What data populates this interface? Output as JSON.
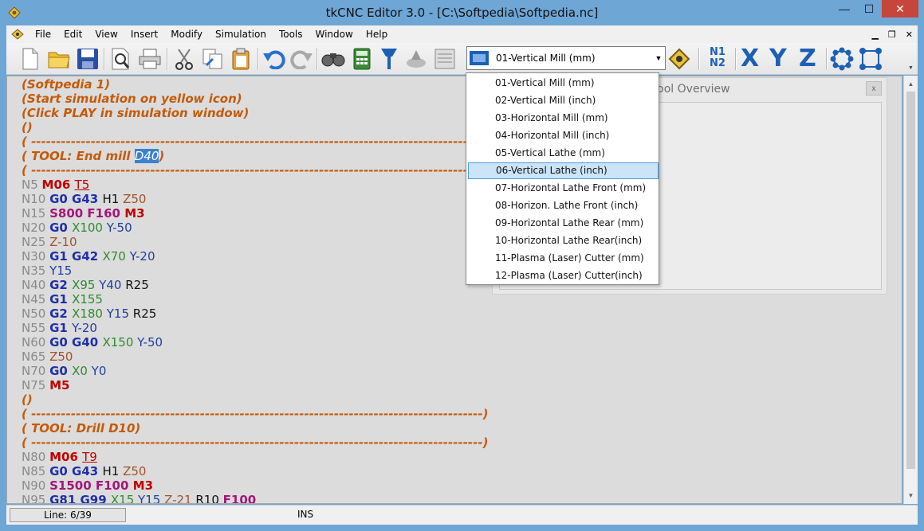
{
  "window": {
    "title": "tkCNC Editor 3.0 - [C:\\Softpedia\\Softpedia.nc]",
    "minimize": "—",
    "maximize": "☐",
    "close": "✕"
  },
  "menu": {
    "items": [
      "File",
      "Edit",
      "View",
      "Insert",
      "Modify",
      "Simulation",
      "Tools",
      "Window",
      "Help"
    ],
    "mdi_minimize": "▁",
    "mdi_restore": "❐",
    "mdi_close": "✕"
  },
  "toolbar": {
    "machine_selected": "01-Vertical Mill (mm)",
    "n1n2_top": "N1",
    "n1n2_bottom": "N2",
    "axis_x": "X",
    "axis_y": "Y",
    "axis_z": "Z",
    "icons": [
      "new-file-icon",
      "open-folder-icon",
      "save-icon",
      "print-preview-icon",
      "print-icon",
      "cut-icon",
      "copy-icon",
      "paste-icon",
      "undo-icon",
      "redo-icon",
      "find-icon",
      "calculator-icon",
      "tool-icon",
      "simulation-icon",
      "machine-icon",
      "tool-insert-icon",
      "renumber-icon",
      "bolt-circle-icon",
      "grid-pattern-icon"
    ]
  },
  "dropdown": {
    "options": [
      "01-Vertical Mill (mm)",
      "02-Vertical Mill (inch)",
      "03-Horizontal Mill (mm)",
      "04-Horizontal Mill (inch)",
      "05-Vertical Lathe (mm)",
      "06-Vertical Lathe (inch)",
      "07-Horizontal Lathe Front (mm)",
      "08-Horizon. Lathe Front (inch)",
      "09-Horizontal Lathe Rear (mm)",
      "10-Horizontal Lathe Rear(inch)",
      "11-Plasma (Laser) Cutter (mm)",
      "12-Plasma (Laser) Cutter(inch)"
    ],
    "highlighted_index": 5
  },
  "tool_panel": {
    "title": "Tool Overview",
    "close": "x"
  },
  "editor": {
    "lines": [
      [
        [
          "cmt",
          "(Softpedia 1)"
        ]
      ],
      [
        [
          "cmt",
          "(Start simulation on yellow icon)"
        ]
      ],
      [
        [
          "cmt",
          "(Click PLAY in simulation window)"
        ]
      ],
      [
        [
          "cmt",
          "()"
        ]
      ],
      [
        [
          "cmt",
          "( -------------------------------------------------------------------------------------------)"
        ]
      ],
      [
        [
          "cmt",
          "( TOOL: End mill "
        ],
        [
          "sel",
          "D40"
        ],
        [
          "cmt",
          ")"
        ]
      ],
      [
        [
          "cmt",
          "( -------------------------------------------------------------------------------------------)"
        ]
      ],
      [
        [
          "num",
          "N5 "
        ],
        [
          "m",
          "M06 "
        ],
        [
          "t",
          "T5"
        ]
      ],
      [
        [
          "num",
          "N10 "
        ],
        [
          "g",
          "G0 G43 "
        ],
        [
          "h",
          "H1 "
        ],
        [
          "z",
          "Z50"
        ]
      ],
      [
        [
          "num",
          "N15 "
        ],
        [
          "sf",
          "S800 F160 "
        ],
        [
          "m",
          "M3"
        ]
      ],
      [
        [
          "num",
          "N20 "
        ],
        [
          "g",
          "G0 "
        ],
        [
          "x",
          "X100 "
        ],
        [
          "y",
          "Y-50"
        ]
      ],
      [
        [
          "num",
          "N25 "
        ],
        [
          "z",
          "Z-10"
        ]
      ],
      [
        [
          "num",
          "N30 "
        ],
        [
          "g",
          "G1 G42 "
        ],
        [
          "x",
          "X70 "
        ],
        [
          "y",
          "Y-20"
        ]
      ],
      [
        [
          "num",
          "N35 "
        ],
        [
          "y",
          "Y15"
        ]
      ],
      [
        [
          "num",
          "N40 "
        ],
        [
          "g",
          "G2 "
        ],
        [
          "x",
          "X95 "
        ],
        [
          "y",
          "Y40 "
        ],
        [
          "r",
          "R25"
        ]
      ],
      [
        [
          "num",
          "N45 "
        ],
        [
          "g",
          "G1 "
        ],
        [
          "x",
          "X155"
        ]
      ],
      [
        [
          "num",
          "N50 "
        ],
        [
          "g",
          "G2 "
        ],
        [
          "x",
          "X180 "
        ],
        [
          "y",
          "Y15 "
        ],
        [
          "r",
          "R25"
        ]
      ],
      [
        [
          "num",
          "N55 "
        ],
        [
          "g",
          "G1 "
        ],
        [
          "y",
          "Y-20"
        ]
      ],
      [
        [
          "num",
          "N60 "
        ],
        [
          "g",
          "G0 G40 "
        ],
        [
          "x",
          "X150 "
        ],
        [
          "y",
          "Y-50"
        ]
      ],
      [
        [
          "num",
          "N65 "
        ],
        [
          "z",
          "Z50"
        ]
      ],
      [
        [
          "num",
          "N70 "
        ],
        [
          "g",
          "G0 "
        ],
        [
          "x",
          "X0 "
        ],
        [
          "y",
          "Y0"
        ]
      ],
      [
        [
          "num",
          "N75 "
        ],
        [
          "m",
          "M5"
        ]
      ],
      [
        [
          "cmt",
          "()"
        ]
      ],
      [
        [
          "cmt",
          "( -------------------------------------------------------------------------------------------)"
        ]
      ],
      [
        [
          "cmt",
          "( TOOL: Drill D10)"
        ]
      ],
      [
        [
          "cmt",
          "( -------------------------------------------------------------------------------------------)"
        ]
      ],
      [
        [
          "num",
          "N80 "
        ],
        [
          "m",
          "M06 "
        ],
        [
          "t",
          "T9"
        ]
      ],
      [
        [
          "num",
          "N85 "
        ],
        [
          "g",
          "G0 G43 "
        ],
        [
          "h",
          "H1 "
        ],
        [
          "z",
          "Z50"
        ]
      ],
      [
        [
          "num",
          "N90 "
        ],
        [
          "sf",
          "S1500 F100 "
        ],
        [
          "m",
          "M3"
        ]
      ],
      [
        [
          "num",
          "N95 "
        ],
        [
          "g",
          "G81 G99 "
        ],
        [
          "x",
          "X15 "
        ],
        [
          "y",
          "Y15 "
        ],
        [
          "z",
          "Z-21 "
        ],
        [
          "r",
          "R10 "
        ],
        [
          "sf",
          "F100"
        ]
      ]
    ]
  },
  "status": {
    "line": "Line: 6/39",
    "mode": "INS"
  },
  "colors": {
    "title_bar": "#6ea6d6",
    "close_button": "#c7463b",
    "editor_bg": "#dcdcdc",
    "comment": "#c45a08",
    "axis_blue": "#1c5fb5"
  }
}
